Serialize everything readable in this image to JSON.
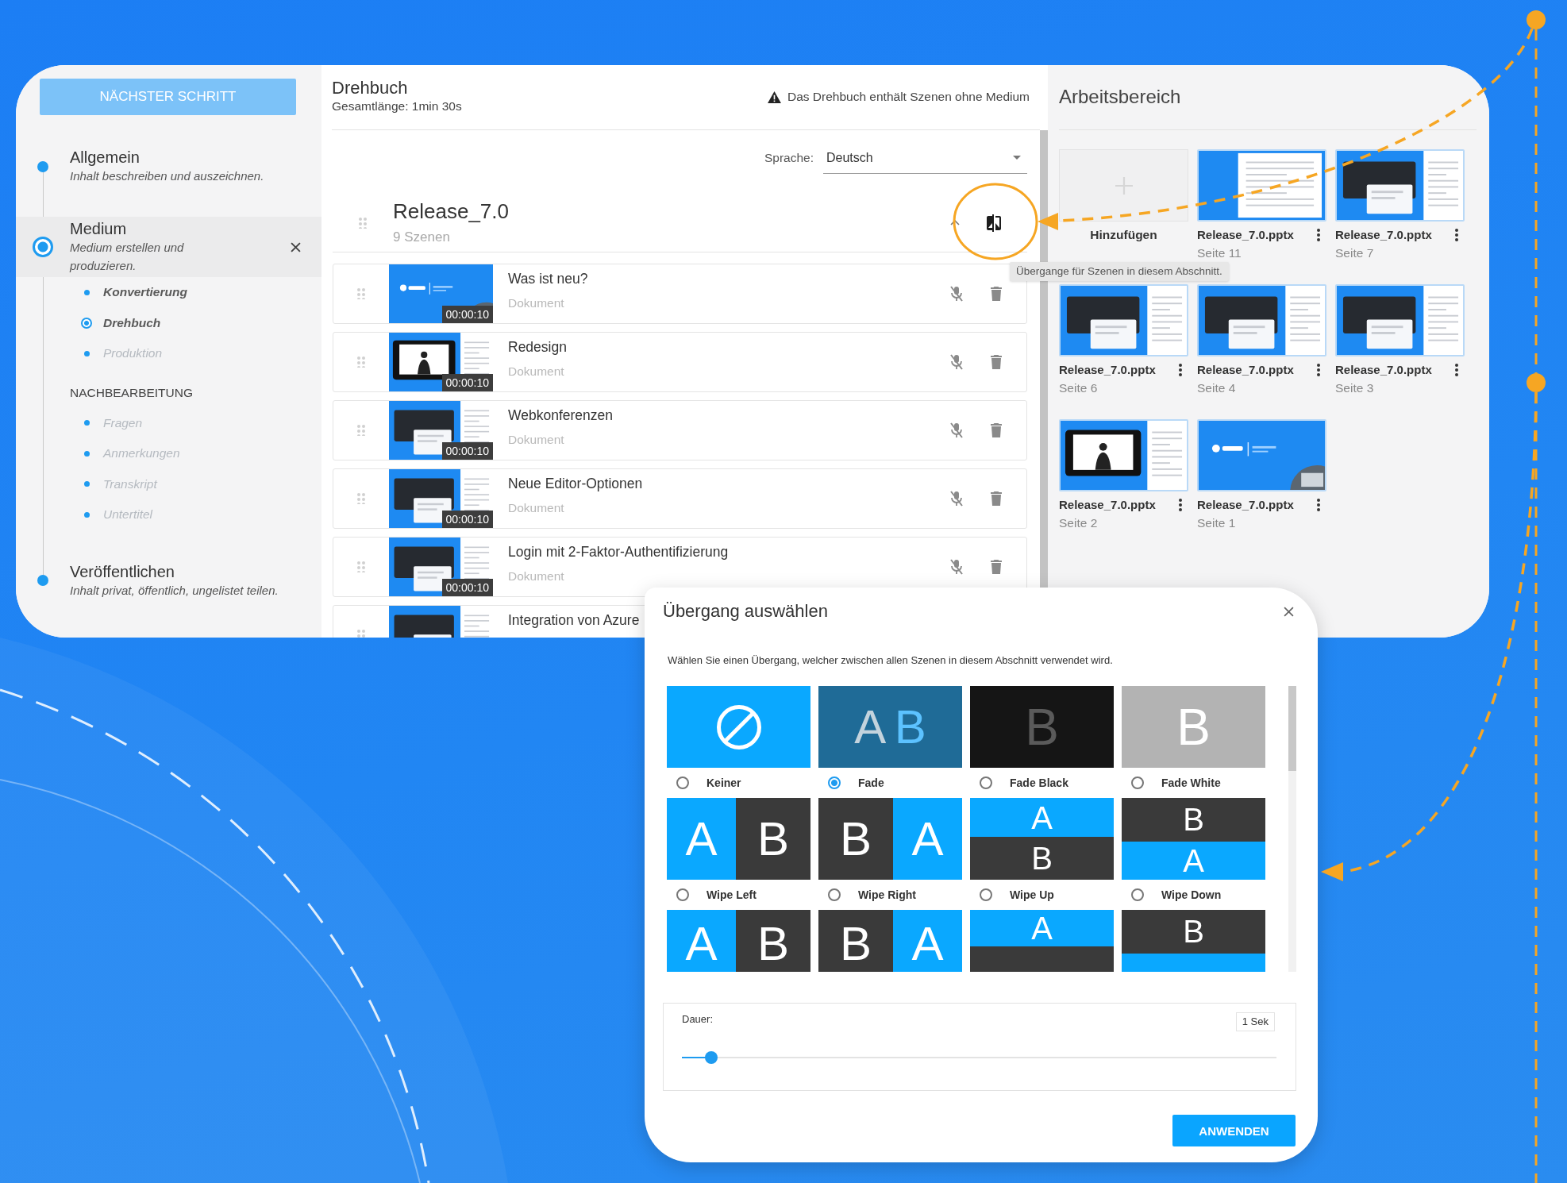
{
  "sidebar": {
    "next_button": {
      "label": "NÄCHSTER SCHRITT",
      "disabled": true
    },
    "steps": [
      {
        "kind": "step",
        "title": "Allgemein",
        "description": "Inhalt beschreiben und auszeichnen.",
        "selected": false
      },
      {
        "kind": "step",
        "title": "Medium",
        "description": "Medium erstellen und produzieren.",
        "selected": true,
        "children": [
          {
            "label": "Konvertierung",
            "selected": false,
            "disabled": false
          },
          {
            "label": "Drehbuch",
            "selected": true,
            "disabled": false
          },
          {
            "label": "Produktion",
            "selected": false,
            "disabled": true
          }
        ]
      },
      {
        "kind": "group",
        "title": "NACHBEARBEITUNG",
        "children": [
          {
            "label": "Fragen",
            "selected": false,
            "disabled": true
          },
          {
            "label": "Anmerkungen",
            "selected": false,
            "disabled": true
          },
          {
            "label": "Transkript",
            "selected": false,
            "disabled": true
          },
          {
            "label": "Untertitel",
            "selected": false,
            "disabled": true
          }
        ]
      },
      {
        "kind": "step",
        "title": "Veröffentlichen",
        "description": "Inhalt privat, öffentlich, ungelistet teilen.",
        "selected": false
      }
    ]
  },
  "script": {
    "title": "Drehbuch",
    "total_length": "Gesamtlänge: 1min 30s",
    "warning": "Das Drehbuch enthält Szenen ohne Medium",
    "language": {
      "label": "Sprache:",
      "value": "Deutsch"
    },
    "section": {
      "title": "Release_7.0",
      "count": "9 Szenen",
      "expanded": true,
      "tooltip": "Übergange für Szenen in diesem Abschnitt.",
      "scenes": [
        {
          "kind": "title_slide",
          "title": "Was ist neu?",
          "type": "Dokument",
          "duration": "00:00:10",
          "muted": true
        },
        {
          "kind": "presenter_slide",
          "title": "Redesign",
          "type": "Dokument",
          "duration": "00:00:10",
          "muted": true
        },
        {
          "kind": "window_slide",
          "title": "Webkonferenzen",
          "type": "Dokument",
          "duration": "00:00:10",
          "muted": true
        },
        {
          "kind": "window_slide",
          "title": "Neue Editor-Optionen",
          "type": "Dokument",
          "duration": "00:00:10",
          "muted": true
        },
        {
          "kind": "window_slide",
          "title": "Login mit 2-Faktor-Authentifizierung",
          "type": "Dokument",
          "duration": "00:00:10",
          "muted": true
        },
        {
          "kind": "window_slide",
          "title": "Integration von Azure"
        }
      ]
    }
  },
  "workspace": {
    "title": "Arbeitsbereich",
    "items": [
      {
        "kind": "add",
        "label": "Hinzufügen"
      },
      {
        "kind": "document_slide",
        "file": "Release_7.0.pptx",
        "page": "Seite 11"
      },
      {
        "kind": "window_slide",
        "file": "Release_7.0.pptx",
        "page": "Seite 7"
      },
      {
        "kind": "window_slide",
        "file": "Release_7.0.pptx",
        "page": "Seite 6"
      },
      {
        "kind": "window_slide",
        "file": "Release_7.0.pptx",
        "page": "Seite 4"
      },
      {
        "kind": "window_slide",
        "file": "Release_7.0.pptx",
        "page": "Seite 3"
      },
      {
        "kind": "presenter_slide",
        "file": "Release_7.0.pptx",
        "page": "Seite 2"
      },
      {
        "kind": "title_slide",
        "file": "Release_7.0.pptx",
        "page": "Seite 1"
      }
    ]
  },
  "dialog": {
    "title": "Übergang auswählen",
    "description": "Wählen Sie einen Übergang, welcher zwischen allen Szenen in diesem Abschnitt verwendet wird.",
    "transitions": [
      {
        "kind": "none",
        "label": "Keiner",
        "selected": false
      },
      {
        "kind": "fade",
        "label": "Fade",
        "selected": true,
        "letters": [
          "A",
          "B"
        ]
      },
      {
        "kind": "fade_black",
        "label": "Fade Black",
        "selected": false,
        "letters": [
          "B"
        ]
      },
      {
        "kind": "fade_white",
        "label": "Fade White",
        "selected": false,
        "letters": [
          "B"
        ]
      },
      {
        "kind": "wipe_left",
        "label": "Wipe Left",
        "selected": false,
        "letters": [
          "A",
          "B"
        ]
      },
      {
        "kind": "wipe_right",
        "label": "Wipe Right",
        "selected": false,
        "letters": [
          "B",
          "A"
        ]
      },
      {
        "kind": "wipe_up",
        "label": "Wipe Up",
        "selected": false,
        "letters": [
          "A",
          "B"
        ]
      },
      {
        "kind": "wipe_down",
        "label": "Wipe Down",
        "selected": false,
        "letters": [
          "B",
          "A"
        ]
      }
    ],
    "more_previews": [
      {
        "kind": "push_left",
        "letters": [
          "A",
          "B"
        ]
      },
      {
        "kind": "push_right",
        "letters": [
          "B",
          "A"
        ]
      },
      {
        "kind": "push_up",
        "letters": [
          "A"
        ]
      },
      {
        "kind": "push_down",
        "letters": [
          "B"
        ]
      }
    ],
    "duration": {
      "label": "Dauer:",
      "value": "1 Sek",
      "level": 0.05
    },
    "apply_button": "ANWENDEN"
  }
}
